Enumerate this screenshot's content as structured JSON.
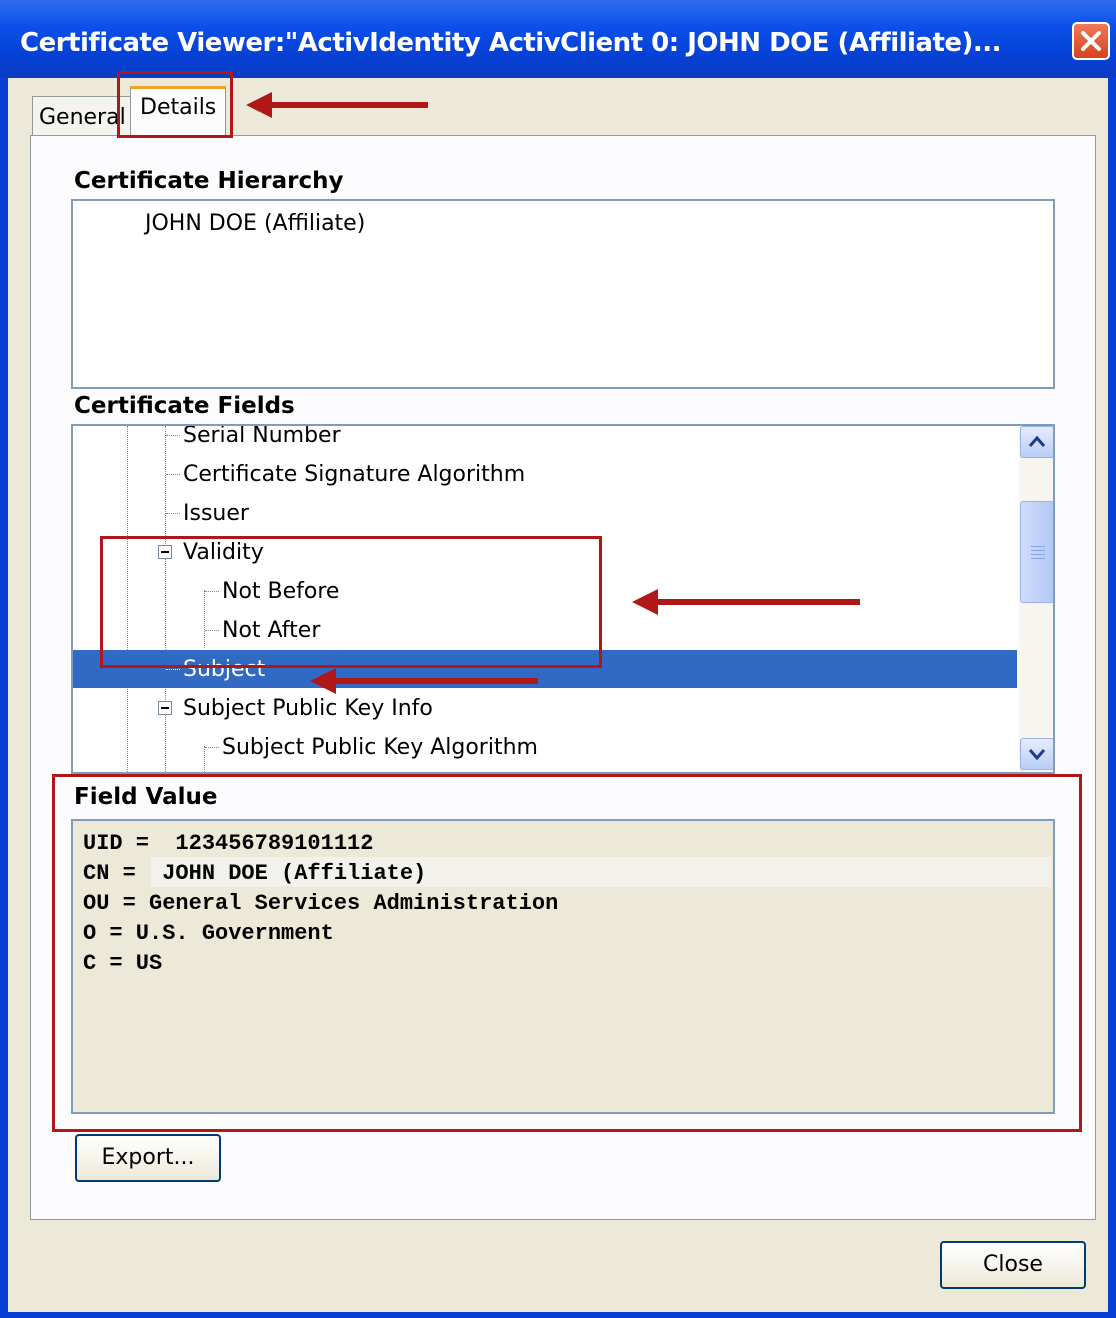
{
  "window": {
    "title": "Certificate Viewer:\"ActivIdentity ActivClient 0: JOHN DOE (Affiliate)..."
  },
  "tabs": [
    {
      "label": "General"
    },
    {
      "label": "Details"
    }
  ],
  "hierarchy": {
    "label": "Certificate Hierarchy",
    "items": [
      "JOHN DOE (Affiliate)"
    ]
  },
  "fields": {
    "label": "Certificate Fields",
    "items": [
      {
        "label": "Serial Number"
      },
      {
        "label": "Certificate Signature Algorithm"
      },
      {
        "label": "Issuer"
      },
      {
        "label": "Validity"
      },
      {
        "label": "Not Before"
      },
      {
        "label": "Not After"
      },
      {
        "label": "Subject"
      },
      {
        "label": "Subject Public Key Info"
      },
      {
        "label": "Subject Public Key Algorithm"
      }
    ],
    "selected": "Subject"
  },
  "field_value": {
    "label": "Field Value",
    "lines": [
      "UID =  123456789101112",
      "CN =  JOHN DOE (Affiliate)",
      "OU = General Services Administration",
      "O = U.S. Government",
      "C = US"
    ]
  },
  "buttons": {
    "export": "Export...",
    "close": "Close"
  },
  "icons": [
    "close-x-icon",
    "collapse-icon",
    "scroll-up-icon",
    "scroll-down-icon",
    "annotation-arrow-icon"
  ],
  "colors": {
    "title_bar": "#0a4fe8",
    "selection": "#316ac5",
    "annotation": "#b01818",
    "dialog_bg": "#ece9d8"
  }
}
